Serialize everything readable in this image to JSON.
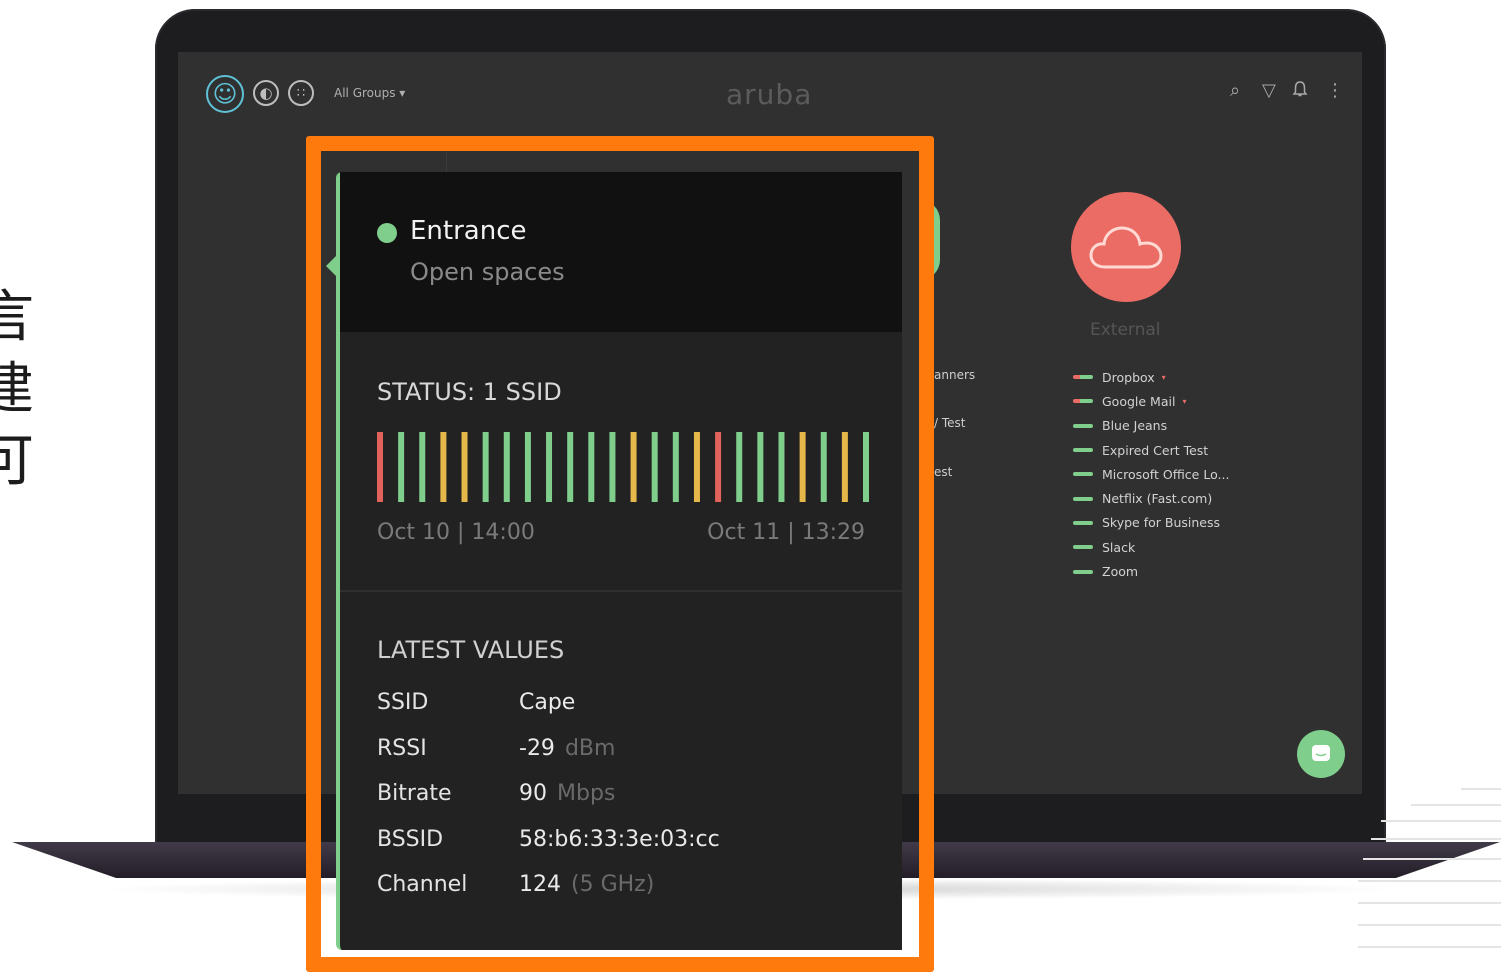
{
  "side_glyphs": [
    "言",
    "建",
    "可"
  ],
  "header": {
    "groups_label": "All Groups ▾",
    "brand": "aruba",
    "icons": [
      "smiley-icon",
      "globe-icon",
      "grid-icon",
      "search-icon",
      "filter-icon",
      "bell-icon",
      "more-icon"
    ]
  },
  "background": {
    "external_label": "External",
    "peek_texts": [
      "anners",
      "/ Test",
      "est"
    ],
    "apps": [
      {
        "name": "Dropbox",
        "warn": true
      },
      {
        "name": "Google Mail",
        "warn": true
      },
      {
        "name": "Blue Jeans",
        "warn": false
      },
      {
        "name": "Expired Cert Test",
        "warn": false
      },
      {
        "name": "Microsoft Office Lo...",
        "warn": false
      },
      {
        "name": "Netflix (Fast.com)",
        "warn": false
      },
      {
        "name": "Skype for Business",
        "warn": false
      },
      {
        "name": "Slack",
        "warn": false
      },
      {
        "name": "Zoom",
        "warn": false
      }
    ]
  },
  "panel": {
    "location": "Entrance",
    "subtitle": "Open spaces",
    "status_title": "STATUS: 1 SSID",
    "status_bars": [
      "red",
      "green",
      "green",
      "yellow",
      "yellow",
      "green",
      "green",
      "green",
      "green",
      "green",
      "green",
      "green",
      "yellow",
      "green",
      "green",
      "yellow",
      "red",
      "green",
      "green",
      "green",
      "yellow",
      "green",
      "yellow",
      "green"
    ],
    "time_start": "Oct 10 | 14:00",
    "time_end": "Oct 11 | 13:29",
    "values_title": "LATEST VALUES",
    "values": [
      {
        "label": "SSID",
        "value": "Cape",
        "unit": ""
      },
      {
        "label": "RSSI",
        "value": "-29",
        "unit": "dBm"
      },
      {
        "label": "Bitrate",
        "value": "90",
        "unit": "Mbps"
      },
      {
        "label": "BSSID",
        "value": "58:b6:33:3e:03:cc",
        "unit": ""
      },
      {
        "label": "Channel",
        "value": "124",
        "unit": "(5 GHz)"
      }
    ]
  },
  "colors": {
    "accent_green": "#7fce8c",
    "bar_red": "#e2625c",
    "bar_yellow": "#e6b84a",
    "bar_green": "#7fce8c",
    "highlight_orange": "#ff7a0d",
    "external_red": "#ea6c64"
  }
}
